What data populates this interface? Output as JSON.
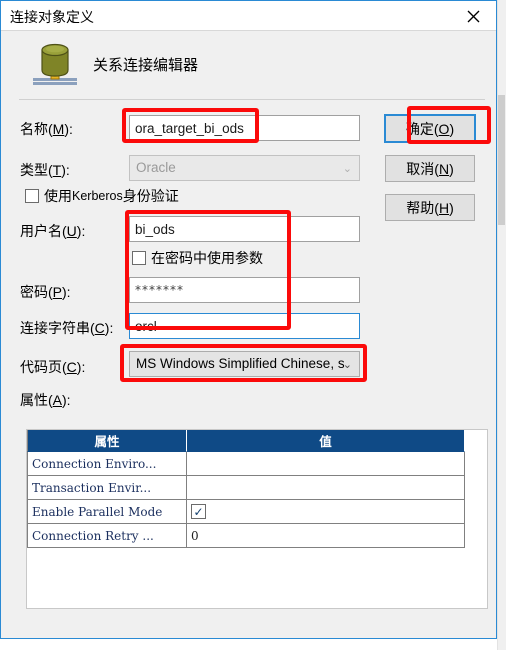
{
  "window": {
    "title": "连接对象定义",
    "close_icon": "close-icon"
  },
  "header": {
    "icon": "database-icon",
    "title": "关系连接编辑器"
  },
  "fields": {
    "name": {
      "label_main": "名称(",
      "label_key": "M",
      "label_end": "):",
      "value": "ora_target_bi_ods"
    },
    "type": {
      "label_main": "类型(",
      "label_key": "T",
      "label_end": "):",
      "value": "Oracle",
      "arrow": "⌄",
      "disabled": true
    },
    "kerberos": {
      "label_pre": "使用 ",
      "label_mid": "Kerberos",
      "label_post": " 身份验证",
      "checked": false
    },
    "username": {
      "label_main": "用户名(",
      "label_key": "U",
      "label_end": "):",
      "value": "bi_ods"
    },
    "param_in_password": {
      "label": "在密码中使用参数",
      "checked": false
    },
    "password": {
      "label_main": "密码(",
      "label_key": "P",
      "label_end": "):",
      "value": "*******"
    },
    "connect_string": {
      "label_main": "连接字符串(",
      "label_key": "C",
      "label_end": "):",
      "value": "orcl",
      "focused": true
    },
    "code_page": {
      "label_main": "代码页(",
      "label_key": "C",
      "label_end": "):",
      "value": "MS Windows Simplified Chinese, s",
      "arrow": "⌄"
    },
    "attributes": {
      "label_main": "属性(",
      "label_key": "A",
      "label_end": "):"
    }
  },
  "buttons": {
    "ok": {
      "main": "确定(",
      "key": "O",
      "end": ")",
      "focused": true
    },
    "cancel": {
      "main": "取消(",
      "key": "N",
      "end": ")"
    },
    "help": {
      "main": "帮助(",
      "key": "H",
      "end": ")"
    }
  },
  "grid": {
    "columns": [
      "属性",
      "值"
    ],
    "rows": [
      {
        "attribute": "Connection Enviro...",
        "value": "",
        "value_type": "text"
      },
      {
        "attribute": "Transaction Envir...",
        "value": "",
        "value_type": "text"
      },
      {
        "attribute": "Enable Parallel Mode",
        "value": "✓",
        "value_type": "checkbox"
      },
      {
        "attribute": "Connection Retry ...",
        "value": "0",
        "value_type": "text"
      }
    ]
  },
  "colors": {
    "accent_blue": "#2a8ad4",
    "grid_header": "#0f4a86",
    "annotation_red": "#fb0a0a",
    "dialog_bg": "#f0f0f0"
  }
}
